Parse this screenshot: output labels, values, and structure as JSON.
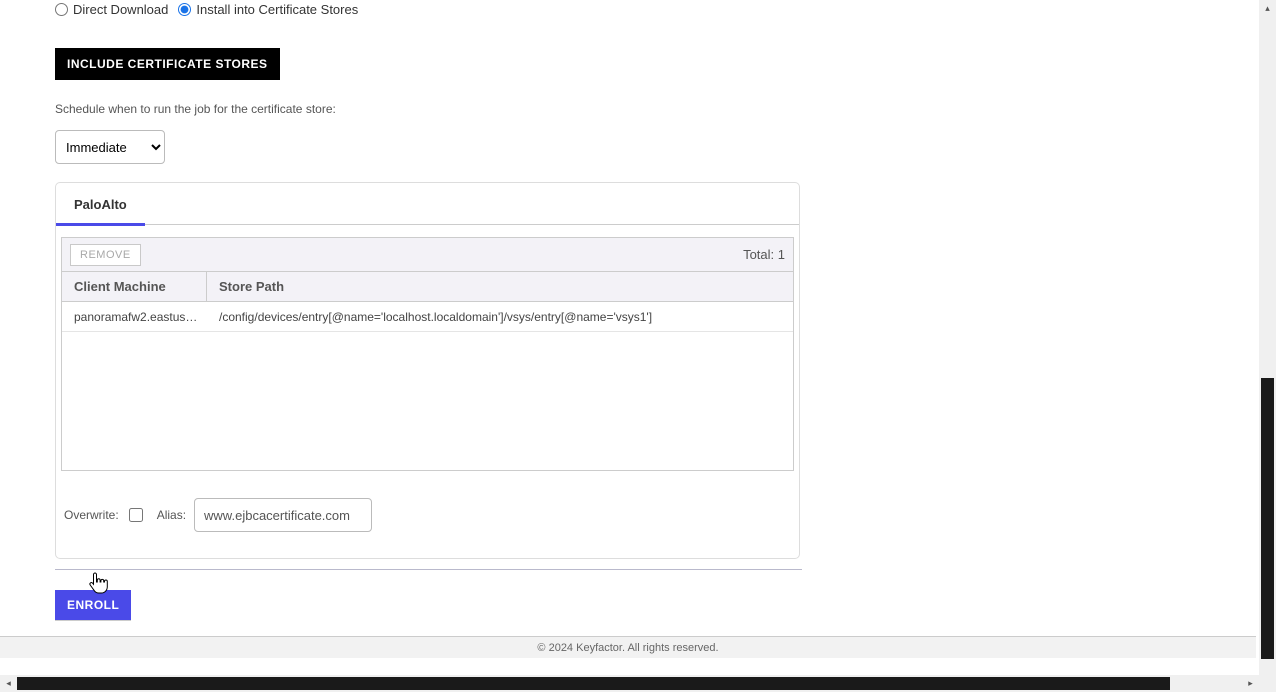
{
  "delivery": {
    "direct_download_label": "Direct Download",
    "install_stores_label": "Install into Certificate Stores",
    "selected": "install"
  },
  "include_stores_button": "INCLUDE CERTIFICATE STORES",
  "schedule_text": "Schedule when to run the job for the certificate store:",
  "schedule_value": "Immediate",
  "stores": {
    "tab_label": "PaloAlto",
    "remove_button": "REMOVE",
    "total_label": "Total: 1",
    "columns": {
      "machine": "Client Machine",
      "path": "Store Path"
    },
    "rows": [
      {
        "machine": "panoramafw2.eastus…",
        "path": "/config/devices/entry[@name='localhost.localdomain']/vsys/entry[@name='vsys1']"
      }
    ],
    "overwrite_label": "Overwrite:",
    "overwrite_checked": false,
    "alias_label": "Alias:",
    "alias_value": "www.ejbcacertificate.com"
  },
  "enroll_button": "ENROLL",
  "footer": "© 2024 Keyfactor. All rights reserved."
}
